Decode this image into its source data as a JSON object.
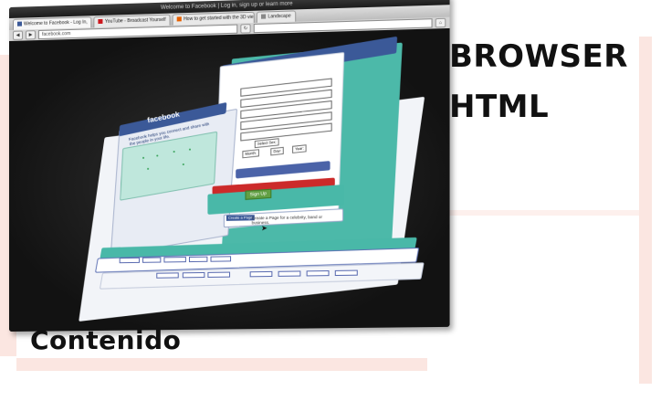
{
  "browser": {
    "window_title": "Welcome to Facebook | Log in, sign up or learn more",
    "tabs": [
      {
        "label": "Welcome to Facebook - Log In,",
        "active": true,
        "icon_color": "#3b5998"
      },
      {
        "label": "YouTube - Broadcast Yourself",
        "active": false,
        "icon_color": "#cc181e"
      },
      {
        "label": "How to get started with the 3D view",
        "active": false,
        "icon_color": "#e66000"
      },
      {
        "label": "Landscape",
        "active": false,
        "icon_color": "#888888"
      }
    ],
    "url": "facebook.com",
    "url_sub": "http://www.facebook.com/",
    "nav": {
      "back": "◀",
      "forward": "▶",
      "reload": "↻",
      "home": "⌂"
    }
  },
  "page": {
    "logo": "facebook",
    "tagline": "Facebook helps you connect and share with the people in your life.",
    "signup_label": "Sign Up",
    "birthday_select": "Select Sex:",
    "month": "Month:",
    "day": "Day:",
    "year": "Year:",
    "page_link": "Create a Page for a celebrity, band or business."
  },
  "labels": {
    "browser": "BROWSER",
    "html": "HTML",
    "contenido": "Contenido"
  },
  "colors": {
    "facebook_blue": "#3b5998",
    "teal_layer": "#49b8a8",
    "red_layer": "#cc2a2a",
    "accent_pink": "#fbe6e1"
  }
}
